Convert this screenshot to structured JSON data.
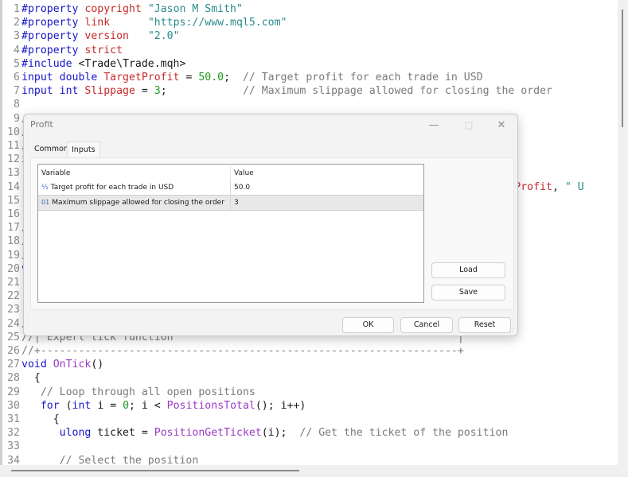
{
  "editor": {
    "lines": [
      {
        "n": "1",
        "tokens": [
          [
            "pp",
            "#property "
          ],
          [
            "prop",
            "copyright"
          ],
          [
            "code",
            " "
          ],
          [
            "str",
            "\"Jason M Smith\""
          ]
        ]
      },
      {
        "n": "2",
        "tokens": [
          [
            "pp",
            "#property "
          ],
          [
            "prop",
            "link"
          ],
          [
            "code",
            "      "
          ],
          [
            "str",
            "\"https://www.mql5.com\""
          ]
        ]
      },
      {
        "n": "3",
        "tokens": [
          [
            "pp",
            "#property "
          ],
          [
            "prop",
            "version"
          ],
          [
            "code",
            "   "
          ],
          [
            "str",
            "\"2.0\""
          ]
        ]
      },
      {
        "n": "4",
        "tokens": [
          [
            "pp",
            "#property "
          ],
          [
            "prop",
            "strict"
          ]
        ]
      },
      {
        "n": "5",
        "tokens": [
          [
            "pp",
            "#include "
          ],
          [
            "code",
            "<Trade\\Trade.mqh>"
          ]
        ]
      },
      {
        "n": "6",
        "tokens": [
          [
            "kw",
            "input double "
          ],
          [
            "id",
            "TargetProfit"
          ],
          [
            "code",
            " = "
          ],
          [
            "num",
            "50.0"
          ],
          [
            "code",
            ";  "
          ],
          [
            "cm",
            "// Target profit for each trade in USD"
          ]
        ]
      },
      {
        "n": "7",
        "tokens": [
          [
            "kw",
            "input int "
          ],
          [
            "id",
            "Slippage"
          ],
          [
            "code",
            " = "
          ],
          [
            "num",
            "3"
          ],
          [
            "code",
            ";            "
          ],
          [
            "cm",
            "// Maximum slippage allowed for closing the order"
          ]
        ]
      },
      {
        "n": "8",
        "tokens": []
      },
      {
        "n": "9",
        "tokens": [
          [
            "cm",
            "/"
          ]
        ]
      },
      {
        "n": "10",
        "tokens": [
          [
            "cm",
            "/"
          ]
        ]
      },
      {
        "n": "11",
        "tokens": [
          [
            "cm",
            "/"
          ]
        ]
      },
      {
        "n": "12",
        "tokens": [
          [
            "kw",
            "i"
          ]
        ]
      },
      {
        "n": "13",
        "tokens": []
      },
      {
        "n": "14",
        "tokens": [
          [
            "code",
            "                                                                          "
          ],
          [
            "id",
            "rgetProfit"
          ],
          [
            "code",
            ", "
          ],
          [
            "str",
            "\" U"
          ]
        ]
      },
      {
        "n": "15",
        "tokens": []
      },
      {
        "n": "16",
        "tokens": []
      },
      {
        "n": "17",
        "tokens": [
          [
            "cm",
            "/"
          ]
        ]
      },
      {
        "n": "18",
        "tokens": [
          [
            "cm",
            "/"
          ]
        ]
      },
      {
        "n": "19",
        "tokens": [
          [
            "cm",
            "/"
          ]
        ]
      },
      {
        "n": "20",
        "tokens": [
          [
            "kw",
            "v"
          ]
        ]
      },
      {
        "n": "21",
        "tokens": []
      },
      {
        "n": "22",
        "tokens": []
      },
      {
        "n": "23",
        "tokens": []
      },
      {
        "n": "24",
        "tokens": [
          [
            "cm",
            "/"
          ]
        ]
      },
      {
        "n": "25",
        "tokens": [
          [
            "cm",
            "//| Expert tick function                                             |"
          ]
        ]
      },
      {
        "n": "26",
        "tokens": [
          [
            "cm",
            "//+------------------------------------------------------------------+"
          ]
        ]
      },
      {
        "n": "27",
        "tokens": [
          [
            "kw",
            "void "
          ],
          [
            "fn",
            "OnTick"
          ],
          [
            "code",
            "()"
          ]
        ]
      },
      {
        "n": "28",
        "tokens": [
          [
            "code",
            "  {"
          ]
        ]
      },
      {
        "n": "29",
        "tokens": [
          [
            "code",
            "   "
          ],
          [
            "cm",
            "// Loop through all open positions"
          ]
        ]
      },
      {
        "n": "30",
        "tokens": [
          [
            "code",
            "   "
          ],
          [
            "kw",
            "for"
          ],
          [
            "code",
            " ("
          ],
          [
            "kw",
            "int"
          ],
          [
            "code",
            " i = "
          ],
          [
            "num",
            "0"
          ],
          [
            "code",
            "; i < "
          ],
          [
            "fn",
            "PositionsTotal"
          ],
          [
            "code",
            "(); i++)"
          ]
        ]
      },
      {
        "n": "31",
        "tokens": [
          [
            "code",
            "     {"
          ]
        ]
      },
      {
        "n": "32",
        "tokens": [
          [
            "code",
            "      "
          ],
          [
            "kw",
            "ulong"
          ],
          [
            "code",
            " ticket = "
          ],
          [
            "fn",
            "PositionGetTicket"
          ],
          [
            "code",
            "(i);  "
          ],
          [
            "cm",
            "// Get the ticket of the position"
          ]
        ]
      },
      {
        "n": "33",
        "tokens": []
      },
      {
        "n": "34",
        "tokens": [
          [
            "code",
            "      "
          ],
          [
            "cm",
            "// Select the position"
          ]
        ]
      }
    ]
  },
  "dialog": {
    "title": "Profit",
    "minimize_icon": "—",
    "maximize_icon": "□",
    "close_icon": "✕",
    "tabs": [
      {
        "label": "Common",
        "active": false
      },
      {
        "label": "Inputs",
        "active": true
      }
    ],
    "table": {
      "headers": [
        "Variable",
        "Value"
      ],
      "rows": [
        {
          "icon": "½",
          "icon_name": "double-type-icon",
          "variable": "Target profit for each trade in USD",
          "value": "50.0",
          "selected": false
        },
        {
          "icon": "01",
          "icon_name": "integer-type-icon",
          "variable": "Maximum slippage allowed for closing the order",
          "value": "3",
          "selected": true
        }
      ]
    },
    "buttons": {
      "load": "Load",
      "save": "Save",
      "ok": "OK",
      "cancel": "Cancel",
      "reset": "Reset"
    }
  }
}
